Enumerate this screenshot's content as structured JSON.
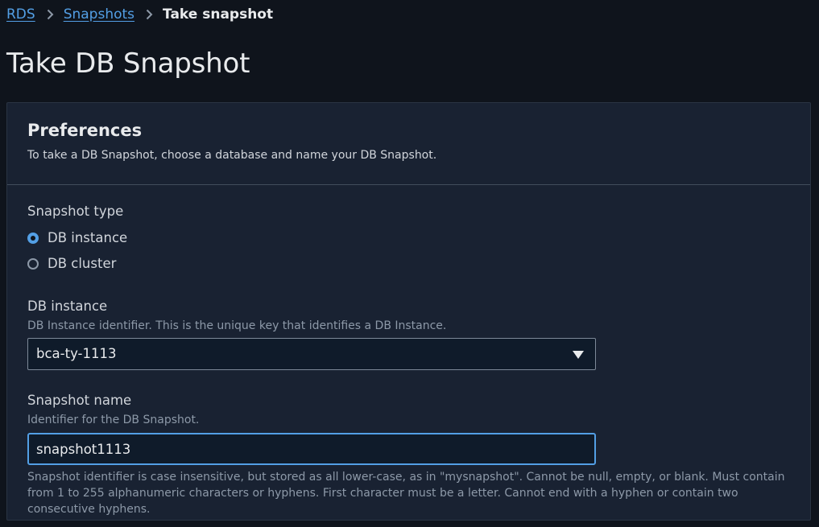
{
  "breadcrumb": {
    "items": [
      {
        "label": "RDS"
      },
      {
        "label": "Snapshots"
      }
    ],
    "current": "Take snapshot"
  },
  "page_title": "Take DB Snapshot",
  "preferences": {
    "title": "Preferences",
    "description": "To take a DB Snapshot, choose a database and name your DB Snapshot."
  },
  "snapshot_type": {
    "label": "Snapshot type",
    "options": [
      {
        "label": "DB instance",
        "selected": true
      },
      {
        "label": "DB cluster",
        "selected": false
      }
    ]
  },
  "db_instance": {
    "label": "DB instance",
    "description": "DB Instance identifier. This is the unique key that identifies a DB Instance.",
    "selected_value": "bca-ty-1113",
    "caret_icon": "caret-down-icon"
  },
  "snapshot_name": {
    "label": "Snapshot name",
    "description": "Identifier for the DB Snapshot.",
    "value": "snapshot1113",
    "constraint": "Snapshot identifier is case insensitive, but stored as all lower-case, as in \"mysnapshot\". Cannot be null, empty, or blank. Must contain from 1 to 255 alphanumeric characters or hyphens. First character must be a letter. Cannot end with a hyphen or contain two consecutive hyphens."
  },
  "colors": {
    "background": "#0f141c",
    "panel": "#192232",
    "accent": "#539fe5",
    "text": "#d1d5db",
    "muted": "#8d99a8"
  }
}
